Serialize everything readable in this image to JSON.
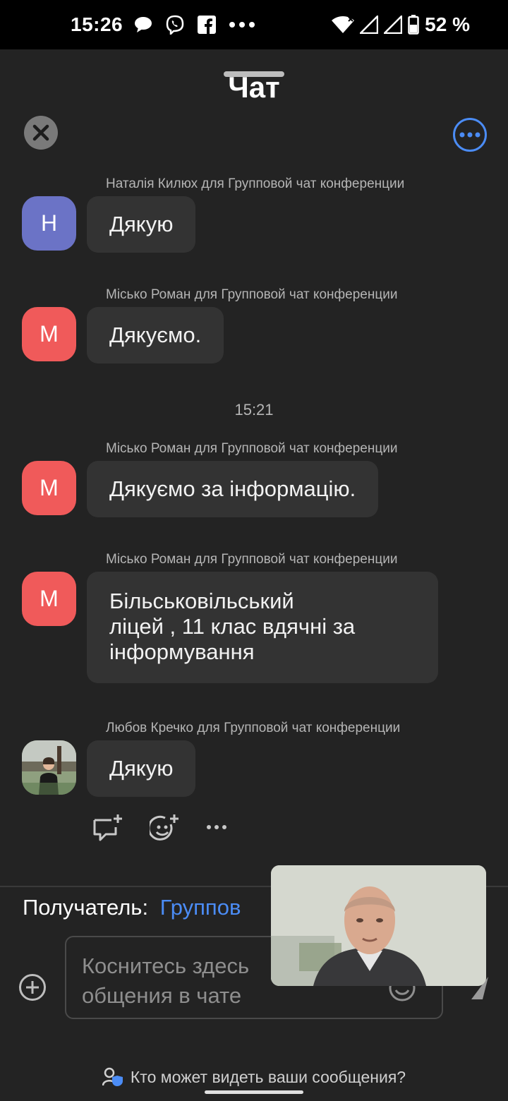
{
  "status_bar": {
    "time": "15:26",
    "battery": "52 %",
    "icons": [
      "chat-bubble-icon",
      "viber-icon",
      "facebook-icon",
      "overflow-dots-icon",
      "wifi-icon",
      "signal-icon",
      "signal-icon",
      "battery-icon"
    ]
  },
  "header": {
    "title": "Чат",
    "close_icon": "close-icon",
    "more_icon": "more-options-icon"
  },
  "messages": [
    {
      "sender": "Наталія Килюх для Групповой чат конференции",
      "avatar_letter": "Н",
      "avatar_color": "#6b73c6",
      "text": "Дякую"
    },
    {
      "sender": "Місько Роман для Групповой чат конференции",
      "avatar_letter": "М",
      "avatar_color": "#f05a5a",
      "text": "Дякуємо."
    },
    {
      "timestamp": "15:21"
    },
    {
      "sender": "Місько Роман для Групповой чат конференции",
      "avatar_letter": "М",
      "avatar_color": "#f05a5a",
      "text": "Дякуємо за інформацію."
    },
    {
      "sender": "Місько Роман для Групповой чат конференции",
      "avatar_letter": "М",
      "avatar_color": "#f05a5a",
      "text_lines": [
        "Більськовільський",
        "ліцей , 11 клас вдячні за",
        "інформування"
      ]
    },
    {
      "sender": "Любов Кречко для Групповой чат конференции",
      "avatar": "photo",
      "text": "Дякую"
    }
  ],
  "message_actions": [
    "reply-icon",
    "add-reaction-icon",
    "more-dots-icon"
  ],
  "composer": {
    "recipient_label": "Получатель:",
    "recipient_value": "Группов",
    "input_line_1": "Коснитесь здесь",
    "input_line_2": "общения в чате",
    "privacy_text": "Кто может видеть ваши сообщения?"
  },
  "colors": {
    "background": "#232323",
    "bubble": "#333333",
    "accent": "#4b8cf5"
  }
}
